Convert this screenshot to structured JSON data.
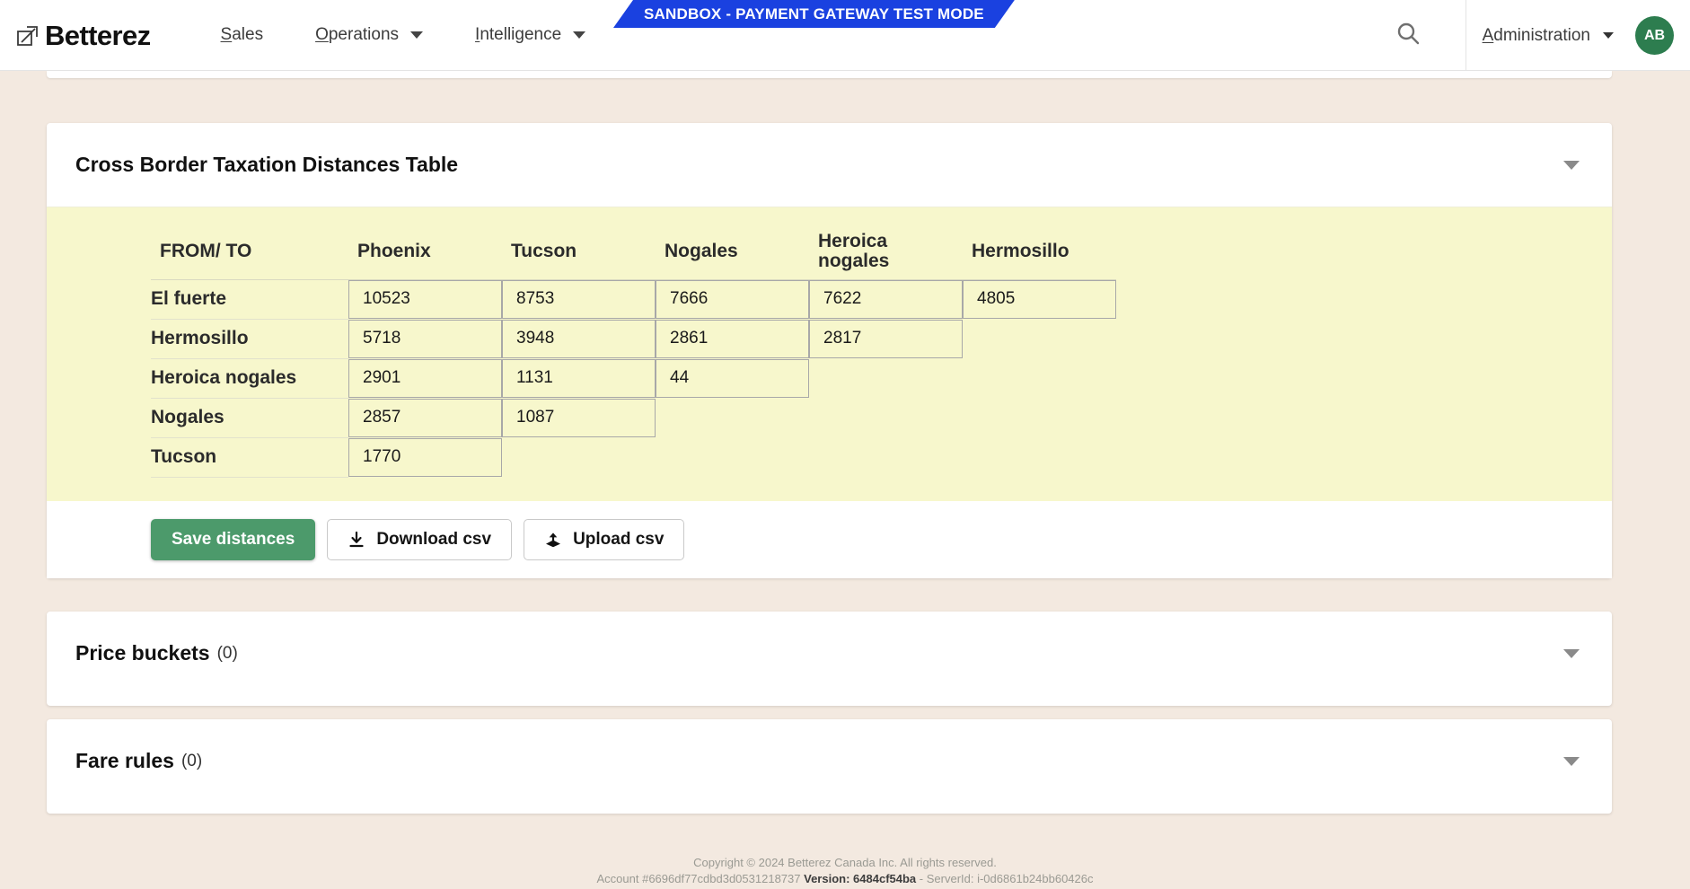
{
  "header": {
    "brand": "Betterez",
    "brand_icon": "arrow-up-right-square-logo",
    "nav": [
      {
        "label": "Sales",
        "accel": "S",
        "has_caret": false
      },
      {
        "label": "Operations",
        "accel": "O",
        "has_caret": true
      },
      {
        "label": "Intelligence",
        "accel": "I",
        "has_caret": true
      }
    ],
    "search_icon": "search-icon",
    "admin_label": "Administration",
    "admin_accel": "A",
    "avatar_initials": "AB",
    "avatar_color": "#2d7d4f"
  },
  "banner": {
    "text": "SANDBOX - PAYMENT GATEWAY TEST MODE",
    "color": "#1a41e0"
  },
  "distances_card": {
    "title": "Cross Border Taxation Distances Table",
    "toggle_icon": "chevron-down-icon",
    "table": {
      "headers": [
        "FROM/ TO",
        "Phoenix",
        "Tucson",
        "Nogales",
        "Heroica nogales",
        "Hermosillo"
      ],
      "rows": [
        {
          "label": "El fuerte",
          "values": [
            "10523",
            "8753",
            "7666",
            "7622",
            "4805"
          ]
        },
        {
          "label": "Hermosillo",
          "values": [
            "5718",
            "3948",
            "2861",
            "2817",
            ""
          ]
        },
        {
          "label": "Heroica nogales",
          "values": [
            "2901",
            "1131",
            "44",
            "",
            ""
          ]
        },
        {
          "label": "Nogales",
          "values": [
            "2857",
            "1087",
            "",
            "",
            ""
          ]
        },
        {
          "label": "Tucson",
          "values": [
            "1770",
            "",
            "",
            "",
            ""
          ]
        }
      ]
    },
    "buttons": {
      "save": "Save distances",
      "download": "Download csv",
      "download_icon": "download-icon",
      "upload": "Upload csv",
      "upload_icon": "upload-icon"
    },
    "accent_color": "#4c9a6b",
    "table_bg": "#f7f7cc"
  },
  "price_card": {
    "title": "Price buckets",
    "count": "(0)",
    "toggle_icon": "chevron-down-icon"
  },
  "fare_card": {
    "title": "Fare rules",
    "count": "(0)",
    "toggle_icon": "chevron-down-icon"
  },
  "footer": {
    "copyright": "Copyright © 2024 Betterez Canada Inc. All rights reserved.",
    "account": "Account #6696df77cdbd3d0531218737",
    "version_label": "Version:",
    "version": "6484cf54ba",
    "server": "- ServerId: i-0d6861b24bb60426c"
  }
}
